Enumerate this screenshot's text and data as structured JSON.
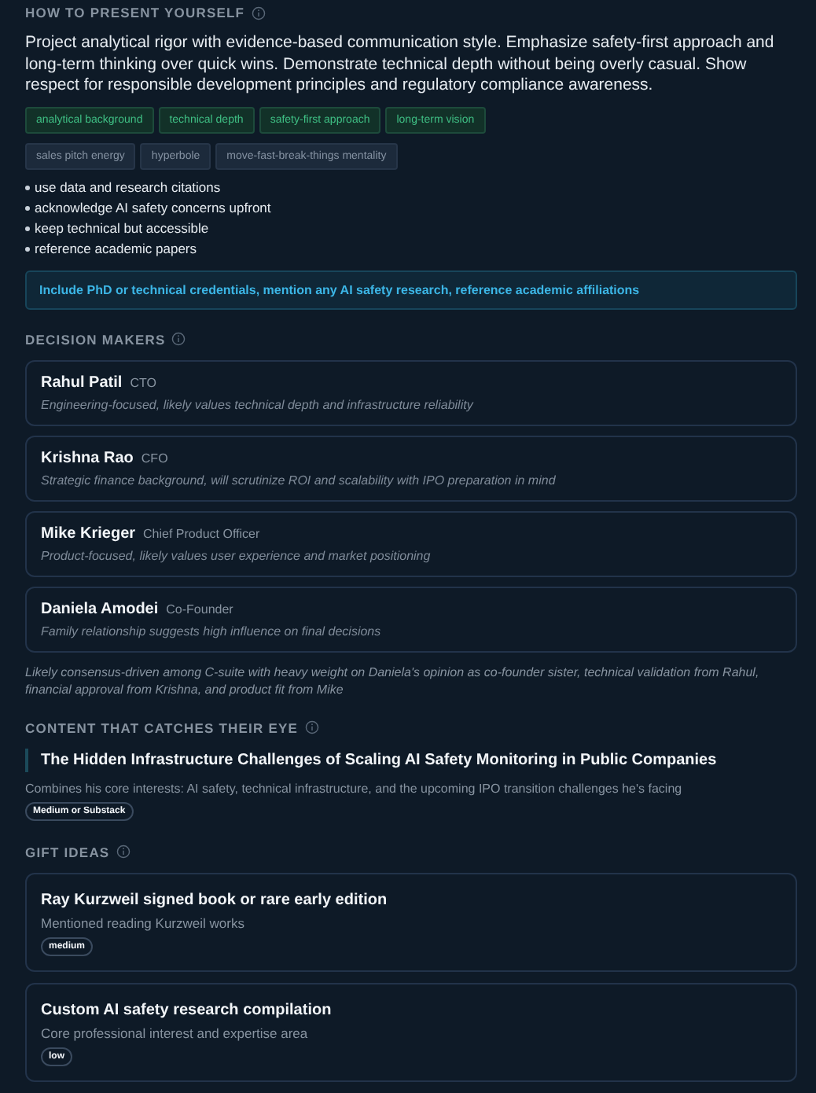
{
  "present": {
    "heading": "HOW TO PRESENT YOURSELF",
    "summary": "Project analytical rigor with evidence-based communication style. Emphasize safety-first approach and long-term thinking over quick wins. Demonstrate technical depth without being overly casual. Show respect for responsible development principles and regulatory compliance awareness.",
    "tags": [
      {
        "label": "analytical background",
        "kind": "emphasize"
      },
      {
        "label": "technical depth",
        "kind": "emphasize"
      },
      {
        "label": "safety-first approach",
        "kind": "emphasize"
      },
      {
        "label": "long-term vision",
        "kind": "emphasize"
      }
    ],
    "avoid_tags": [
      {
        "label": "sales pitch energy",
        "kind": "avoid"
      },
      {
        "label": "hyperbole",
        "kind": "avoid"
      },
      {
        "label": "move-fast-break-things mentality",
        "kind": "avoid"
      }
    ],
    "tips": [
      "use data and research citations",
      "acknowledge AI safety concerns upfront",
      "keep technical but accessible",
      "reference academic papers"
    ],
    "callout": "Include PhD or technical credentials, mention any AI safety research, reference academic affiliations"
  },
  "decision_makers": {
    "heading": "DECISION MAKERS",
    "people": [
      {
        "name": "Rahul Patil",
        "role": "CTO",
        "note": "Engineering-focused, likely values technical depth and infrastructure reliability"
      },
      {
        "name": "Krishna Rao",
        "role": "CFO",
        "note": "Strategic finance background, will scrutinize ROI and scalability with IPO preparation in mind"
      },
      {
        "name": "Mike Krieger",
        "role": "Chief Product Officer",
        "note": "Product-focused, likely values user experience and market positioning"
      },
      {
        "name": "Daniela Amodei",
        "role": "Co-Founder",
        "note": "Family relationship suggests high influence on final decisions"
      }
    ],
    "summary": "Likely consensus-driven among C-suite with heavy weight on Daniela's opinion as co-founder sister, technical validation from Rahul, financial approval from Krishna, and product fit from Mike"
  },
  "content": {
    "heading": "CONTENT THAT CATCHES THEIR EYE",
    "title": "The Hidden Infrastructure Challenges of Scaling AI Safety Monitoring in Public Companies",
    "reason": "Combines his core interests: AI safety, technical infrastructure, and the upcoming IPO transition challenges he's facing",
    "platform": "Medium or Substack"
  },
  "gifts": {
    "heading": "GIFT IDEAS",
    "items": [
      {
        "title": "Ray Kurzweil signed book or rare early edition",
        "reason": "Mentioned reading Kurzweil works",
        "budget": "medium"
      },
      {
        "title": "Custom AI safety research compilation",
        "reason": "Core professional interest and expertise area",
        "budget": "low"
      }
    ]
  }
}
